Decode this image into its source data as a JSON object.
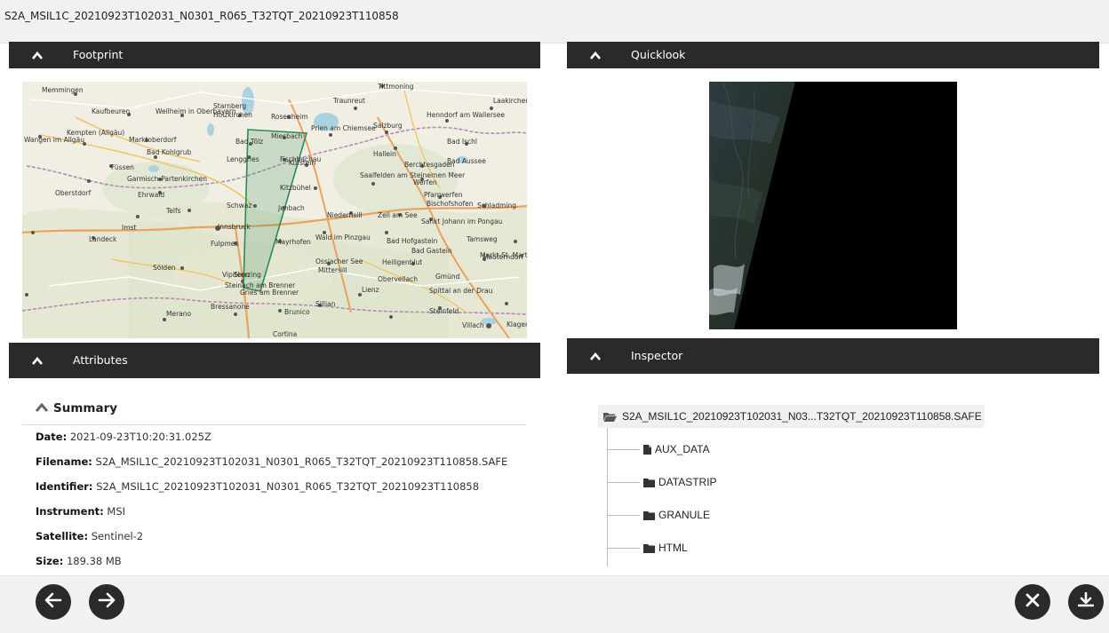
{
  "window": {
    "title": "S2A_MSIL1C_20210923T102031_N0301_R065_T32TQT_20210923T110858"
  },
  "panels": {
    "footprint": {
      "label": "Footprint",
      "toggle_icon": "chevron-up-icon"
    },
    "quicklook": {
      "label": "Quicklook",
      "toggle_icon": "chevron-up-icon"
    },
    "attributes": {
      "label": "Attributes",
      "toggle_icon": "chevron-up-icon"
    },
    "inspector": {
      "label": "Inspector",
      "toggle_icon": "chevron-up-icon"
    }
  },
  "map": {
    "labels": [
      "Memmingen",
      "Kaufbeuren",
      "Weilheim in Oberbayern",
      "Starnberg",
      "Holzkirchen",
      "Rosenheim",
      "Traunreut",
      "Tittmoning",
      "Salzburg",
      "Laakirchen",
      "Wangen im Allgäu",
      "Kempten (Allgäu)",
      "Marktoberdorf",
      "Bad Kohlgrub",
      "Bad Tölz",
      "Miesbach",
      "Prien am Chiemsee",
      "Henndorf am Wallersee",
      "Bad Ischl",
      "Füssen",
      "Garmisch-Partenkirchen",
      "Lenggries",
      "Fischbachau",
      "Kufstein",
      "Hallein",
      "Berchtesgaden",
      "Bad Aussee",
      "Oberstdorf",
      "Ehrwald",
      "Kitzbühel",
      "Saalfelden am Steinernen Meer",
      "Werfen",
      "Pfarrwerfen",
      "Bischofshofen",
      "Schladming",
      "Imst",
      "Telfs",
      "Schwaz",
      "Jenbach",
      "Niedernsill",
      "Zell am See",
      "Sankt Johann im Pongau",
      "Landeck",
      "Innsbruck",
      "Fulpmes",
      "Mayrhofen",
      "Wald im Pinzgau",
      "Bad Hofgastein",
      "Tamsweg",
      "Mauterndorf",
      "Sölden",
      "Steinach am Brenner",
      "Mittersill",
      "Bad Gastein",
      "Markt-St. Martin im Lungau",
      "Vipiteno",
      "Gries am Brenner",
      "Ossiacher See",
      "Heiligenblut",
      "Obervellach",
      "Gmünd",
      "Spittal an der Drau",
      "Merano",
      "Bressanone",
      "Brunico",
      "Sillian",
      "Lienz",
      "Steinfeld",
      "Villach",
      "Klagenfurt",
      "Sterzing",
      "Cortina"
    ],
    "footprint_color": "#2e8b57"
  },
  "summary": {
    "title": "Summary",
    "toggle_icon": "chevron-up-icon",
    "date_label": "Date:",
    "date_value": "2021-09-23T10:20:31.025Z",
    "filename_label": "Filename:",
    "filename_value": "S2A_MSIL1C_20210923T102031_N0301_R065_T32TQT_20210923T110858.SAFE",
    "identifier_label": "Identifier:",
    "identifier_value": "S2A_MSIL1C_20210923T102031_N0301_R065_T32TQT_20210923T110858",
    "instrument_label": "Instrument:",
    "instrument_value": "MSI",
    "satellite_label": "Satellite:",
    "satellite_value": "Sentinel-2",
    "size_label": "Size:",
    "size_value": "189.38 MB"
  },
  "inspector": {
    "root": {
      "label": "S2A_MSIL1C_20210923T102031_N03...T32TQT_20210923T110858.SAFE",
      "icon": "folder-open-icon"
    },
    "children": [
      {
        "label": "AUX_DATA",
        "icon": "file-icon"
      },
      {
        "label": "DATASTRIP",
        "icon": "folder-icon"
      },
      {
        "label": "GRANULE",
        "icon": "folder-icon"
      },
      {
        "label": "HTML",
        "icon": "folder-icon"
      }
    ]
  },
  "bottom": {
    "prev_icon": "arrow-left-icon",
    "next_icon": "arrow-right-icon",
    "close_icon": "close-icon",
    "download_icon": "download-icon"
  }
}
